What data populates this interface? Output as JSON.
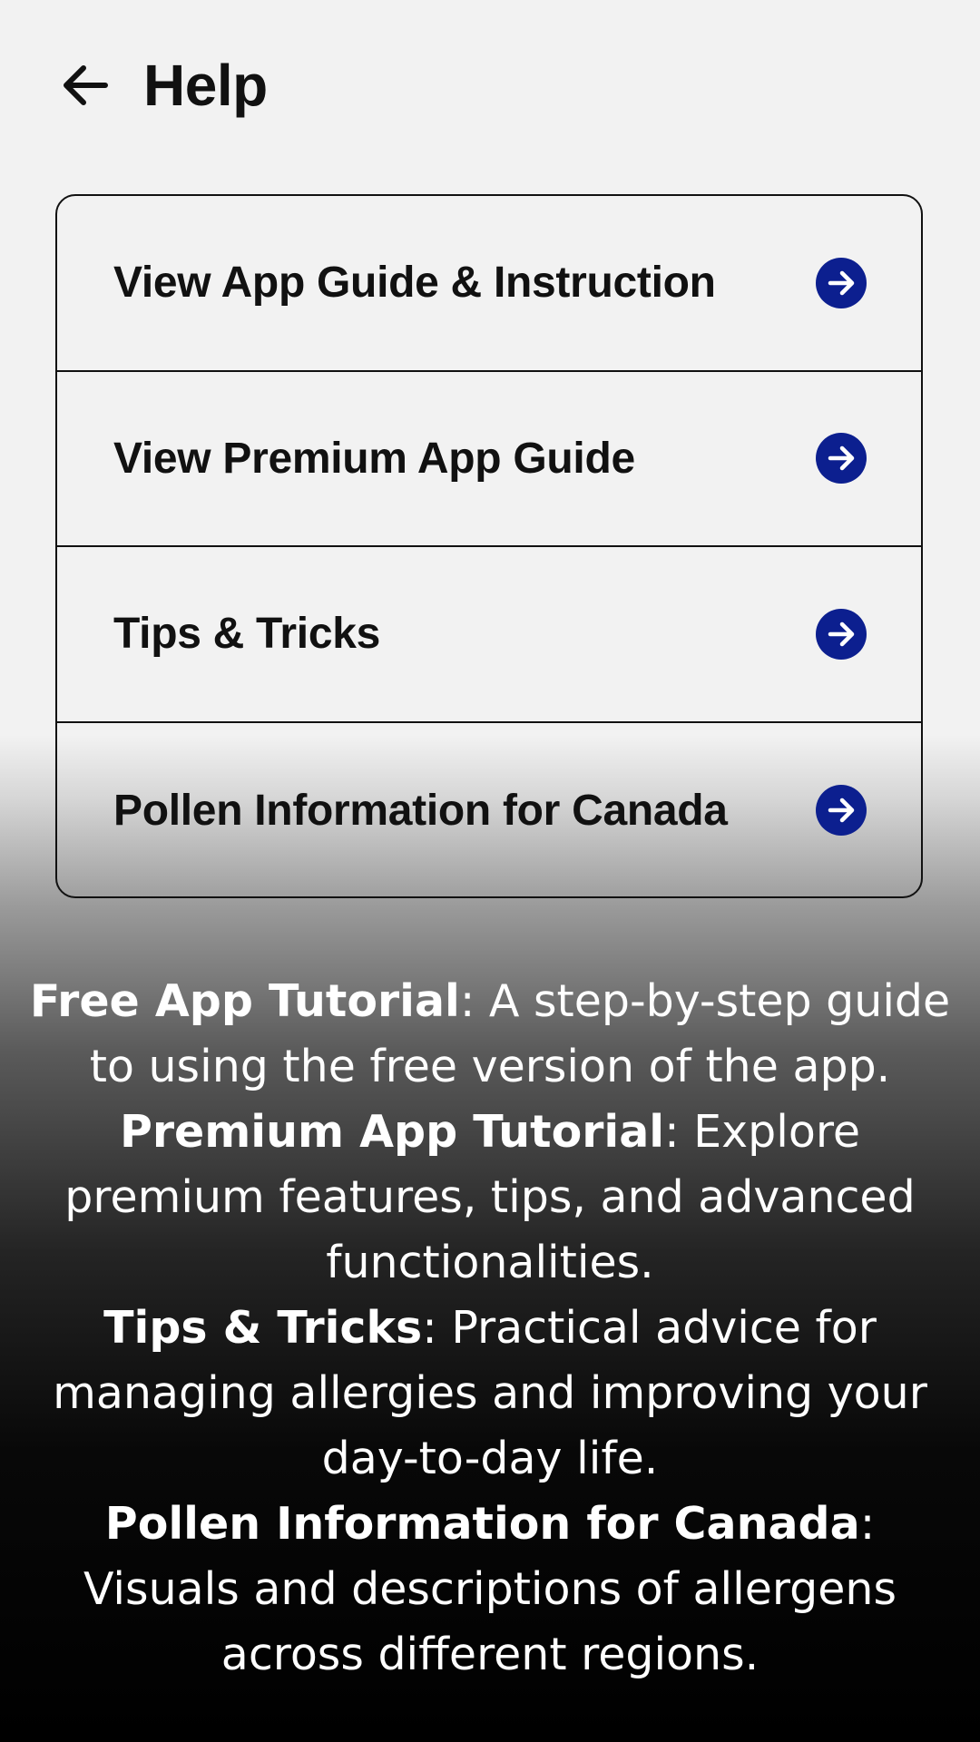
{
  "header": {
    "title": "Help",
    "back_icon": "arrow-left-icon"
  },
  "menu": {
    "items": [
      {
        "label": "View App Guide & Instruction",
        "icon": "arrow-right-circle-icon"
      },
      {
        "label": "View Premium App Guide",
        "icon": "arrow-right-circle-icon"
      },
      {
        "label": "Tips & Tricks",
        "icon": "arrow-right-circle-icon"
      },
      {
        "label": "Pollen Information for Canada",
        "icon": "arrow-right-circle-icon"
      }
    ]
  },
  "descriptions": [
    {
      "title": "Free App Tutorial",
      "text": ": A step-by-step guide to using the free version of the app."
    },
    {
      "title": "Premium App Tutorial",
      "text": ": Explore premium features, tips, and advanced functionalities."
    },
    {
      "title": "Tips & Tricks",
      "text": ": Practical advice for managing allergies and improving your day-to-day life."
    },
    {
      "title": "Pollen Information for Canada",
      "text": ": Visuals and descriptions of allergens across different regions."
    }
  ],
  "colors": {
    "accent": "#0c1f8f",
    "text_dark": "#111111",
    "background_top": "#f2f2f2",
    "background_bottom": "#000000"
  }
}
